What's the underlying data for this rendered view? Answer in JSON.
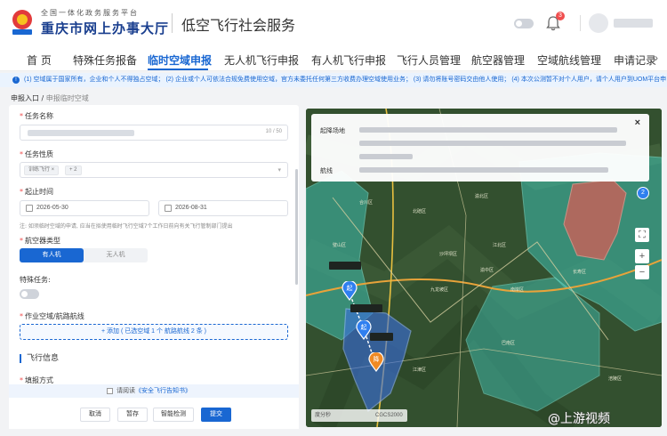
{
  "header": {
    "logo_top": "全国一体化政务服务平台",
    "logo_main": "重庆市网上办事大厅",
    "app_title": "低空飞行社会服务",
    "notification_count": "3"
  },
  "nav": {
    "items": [
      "首 页",
      "特殊任务报备",
      "临时空域申报",
      "无人机飞行申报",
      "有人机飞行申报",
      "飞行人员管理",
      "航空器管理",
      "空域航线管理",
      "申请记录"
    ],
    "active_index": 2
  },
  "notice": {
    "text": "(1) 空域属于国家所有，企业和个人不得独占空域；  (2) 企业或个人可依法合规免费使用空域，官方未委托任何第三方收费办理空域使用业务；  (3) 请勿将账号密码交由他人使用；  (4) 本次公测暂不对个人用户，请个人用户到UOM平台申…"
  },
  "breadcrumb": {
    "root": "申报入口",
    "sep": " / ",
    "current": "申报临时空域"
  },
  "form": {
    "task_name": {
      "label": "任务名称",
      "counter": "10 / 50"
    },
    "task_type": {
      "label": "任务性质",
      "tag": "训练飞行",
      "more": "+ 2"
    },
    "period": {
      "label": "起止时间",
      "start": "2026-05-30",
      "end": "2026-08-31"
    },
    "hint": "注: 如须临时空域的申请, 应当在拟使用临时飞行空域7个工作日前向有关飞行管制部门提出",
    "aircraft_type": {
      "label": "航空器类型",
      "options": [
        "有人机",
        "无人机"
      ],
      "selected": "有人机"
    },
    "special_task": {
      "label": "特殊任务:"
    },
    "airspace": {
      "label": "作业空域/航路航线",
      "add_text": "+ 添加 ( 已选空域 1 个  航路航线 2 条 )"
    },
    "section_title": "飞行信息",
    "fill_method_label": "填报方式"
  },
  "agreement": {
    "prefix": "请阅读",
    "link": "《安全飞行告知书》"
  },
  "actions": {
    "cancel": "取消",
    "save": "暂存",
    "check": "智能检测",
    "submit": "提交"
  },
  "map": {
    "popup": {
      "field_airport": "起降场地",
      "field_route": "航线",
      "close": "×"
    },
    "pins": [
      "起",
      "起",
      "降"
    ],
    "cluster_count": "2",
    "scale_text": "度分秒",
    "crs_text": "CGCS2000",
    "place_labels": [
      "合川区",
      "北碚区",
      "渝北区",
      "沙坪坝区",
      "江北区",
      "渝中区",
      "九龙坡区",
      "南岸区",
      "巴南区",
      "璧山区",
      "江津区",
      "长寿区",
      "涪陵区"
    ]
  },
  "watermark": "@上游视频"
}
